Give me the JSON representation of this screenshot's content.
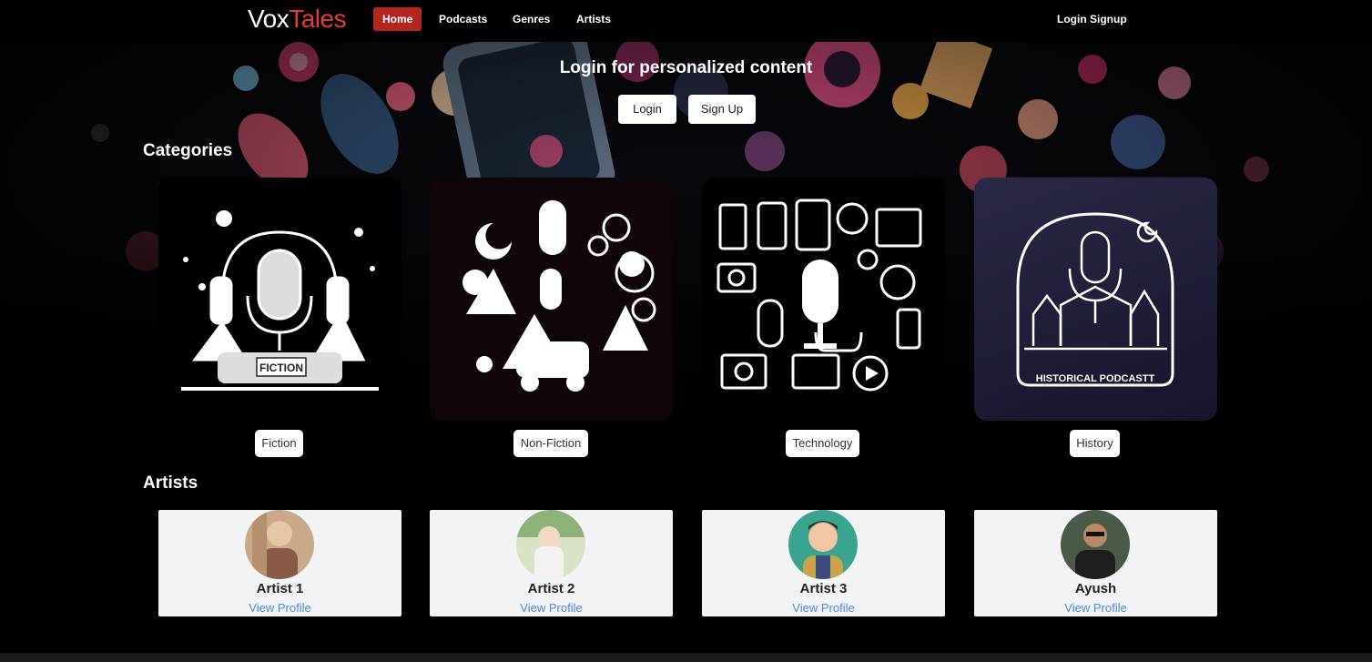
{
  "brand": {
    "part1": "Vox",
    "part2": "Tales"
  },
  "nav": {
    "items": [
      {
        "label": "Home",
        "active": true
      },
      {
        "label": "Podcasts"
      },
      {
        "label": "Genres"
      },
      {
        "label": "Artists"
      }
    ],
    "login": "Login",
    "signup": "Signup"
  },
  "hero": {
    "title": "Login for personalized content",
    "login_button": "Login",
    "signup_button": "Sign Up"
  },
  "categories": {
    "title": "Categories",
    "items": [
      {
        "label": "Fiction",
        "art_text": "FICTION"
      },
      {
        "label": "Non-Fiction"
      },
      {
        "label": "Technology"
      },
      {
        "label": "History",
        "art_text": "HISTORICAL PODCASTT"
      }
    ]
  },
  "artists": {
    "title": "Artists",
    "items": [
      {
        "name": "Artist 1",
        "link": "View Profile"
      },
      {
        "name": "Artist 2",
        "link": "View Profile"
      },
      {
        "name": "Artist 3",
        "link": "View Profile"
      },
      {
        "name": "Ayush",
        "link": "View Profile"
      }
    ]
  },
  "colors": {
    "accent": "#b3261e",
    "brand_red": "#e23a3a",
    "link": "#4a8be8",
    "card_bg": "#f2f3f5"
  }
}
